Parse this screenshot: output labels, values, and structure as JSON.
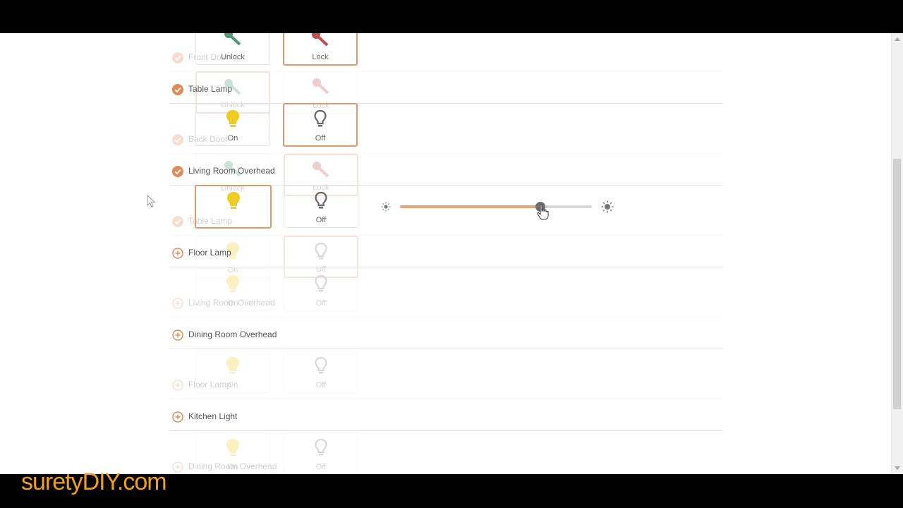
{
  "colors": {
    "accent": "#e08a55",
    "accent_light": "#e09a70",
    "unlock_green": "#4f9a74",
    "lock_red": "#c05050",
    "bulb_on": "#f0cc20",
    "bulb_off": "#777777",
    "brand": "#f0a020"
  },
  "brand": {
    "text": "suretyDIY.com"
  },
  "devices": {
    "front_door": {
      "label": "Front Door",
      "status": "checked"
    },
    "table_lamp": {
      "label": "Table Lamp",
      "status": "checked"
    },
    "back_door": {
      "label": "Back Door",
      "status": "checked"
    },
    "living_room_overhead": {
      "label": "Living Room Overhead",
      "status": "checked"
    },
    "table_lamp_2": {
      "label": "Table Lamp",
      "status": "checked"
    },
    "floor_lamp": {
      "label": "Floor Lamp",
      "status": "add"
    },
    "living_room_overhead_2": {
      "label": "Living Room Overhead",
      "status": "add"
    },
    "dining_room_overhead": {
      "label": "Dining Room Overhead",
      "status": "add"
    },
    "floor_lamp_2": {
      "label": "Floor Lamp",
      "status": "add"
    },
    "kitchen_light": {
      "label": "Kitchen Light",
      "status": "add"
    },
    "dining_room_overhead_2": {
      "label": "Dining Room Overhead",
      "status": "add"
    }
  },
  "controls": {
    "unlock_label": "Unlock",
    "lock_label": "Lock",
    "on_label": "On",
    "off_label": "Off"
  },
  "dimmer": {
    "value_percent": 73,
    "min_icon": "sun-small-icon",
    "max_icon": "sun-large-icon"
  }
}
